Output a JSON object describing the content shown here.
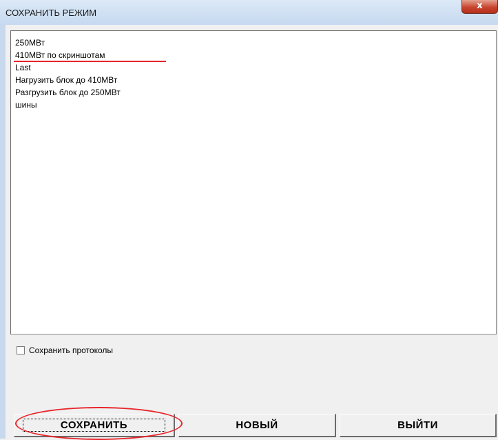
{
  "window": {
    "title": "СОХРАНИТЬ РЕЖИМ",
    "close_glyph": "x"
  },
  "list": {
    "items": [
      "250МВт",
      "410МВт по скриншотам",
      "Last",
      "Нагрузить блок до 410МВт",
      "Разгрузить блок до 250МВт",
      "шины"
    ]
  },
  "options": {
    "save_protocols_label": "Сохранить протоколы",
    "save_protocols_checked": false
  },
  "buttons": {
    "save_label": "СОХРАНИТЬ",
    "new_label": "НОВЫЙ",
    "exit_label": "ВЫЙТИ"
  },
  "annotations": {
    "color": "#e8242a"
  }
}
